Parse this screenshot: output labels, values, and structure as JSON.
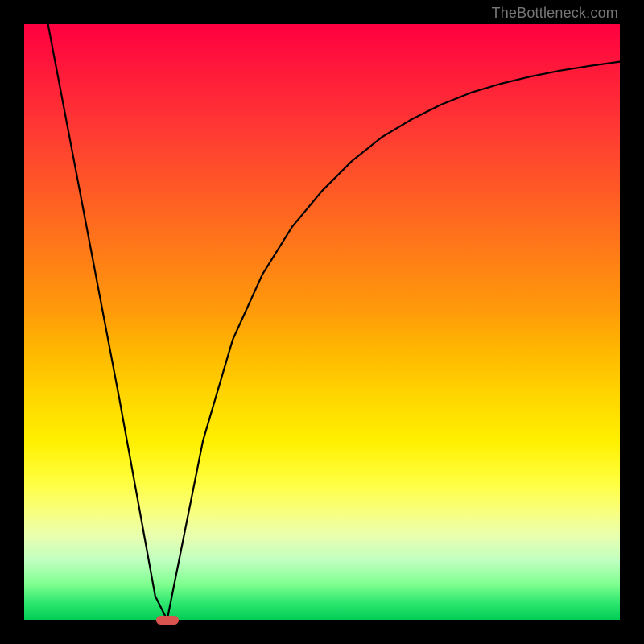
{
  "watermark": "TheBottleneck.com",
  "chart_data": {
    "type": "line",
    "title": "",
    "xlabel": "",
    "ylabel": "",
    "xlim": [
      0,
      100
    ],
    "ylim": [
      0,
      100
    ],
    "grid": false,
    "legend": false,
    "series": [
      {
        "name": "curve",
        "x": [
          4,
          8,
          12,
          16,
          18,
          20,
          22,
          24,
          26,
          30,
          35,
          40,
          45,
          50,
          55,
          60,
          65,
          70,
          75,
          80,
          85,
          90,
          95,
          100
        ],
        "values": [
          100,
          79,
          58,
          37,
          26,
          15,
          4,
          0,
          10,
          30,
          47,
          58,
          66,
          72,
          77,
          81,
          84,
          86.5,
          88.5,
          90,
          91.2,
          92.2,
          93,
          93.7
        ]
      }
    ],
    "marker": {
      "x": 24,
      "y": 0,
      "color": "#d9534f"
    },
    "background_gradient": [
      "#ff0040",
      "#ffd400",
      "#ffff40",
      "#00cc55"
    ]
  }
}
